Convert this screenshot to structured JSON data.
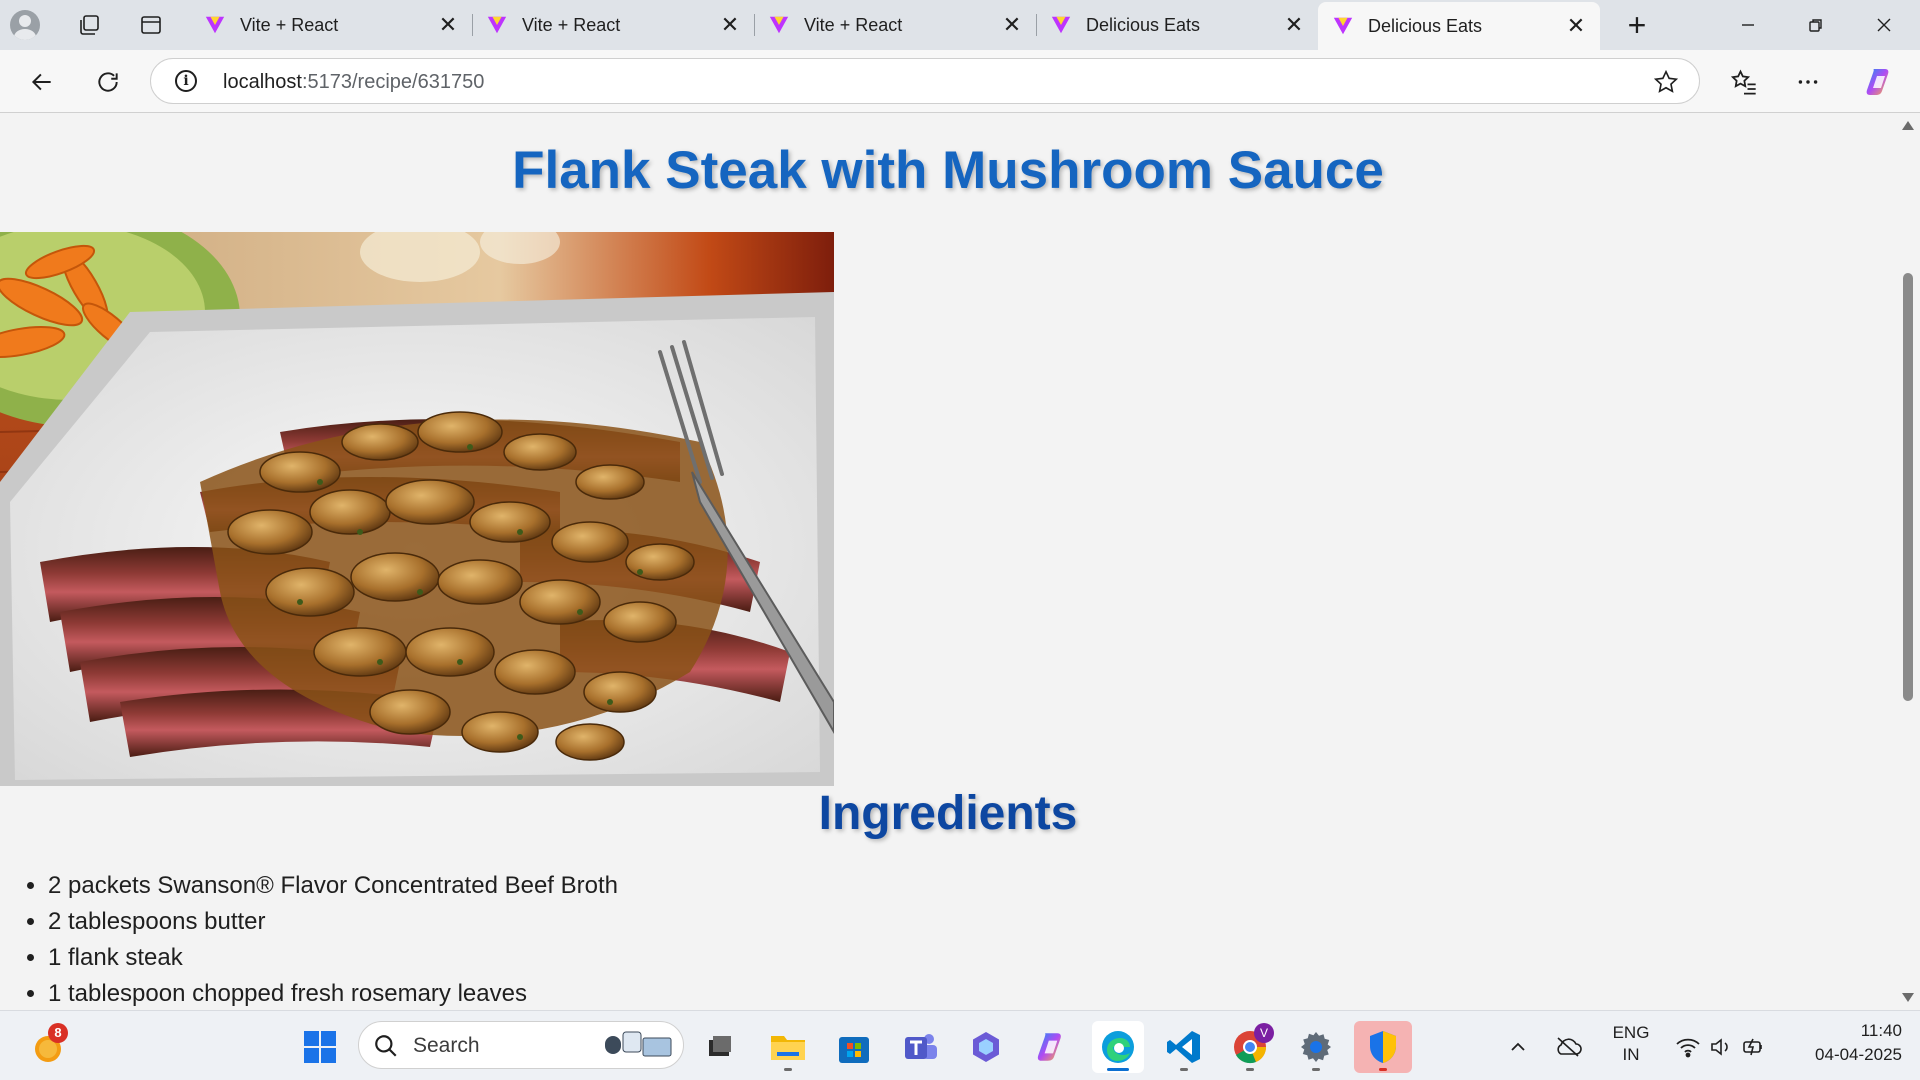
{
  "browser": {
    "tabs": [
      {
        "title": "Vite + React"
      },
      {
        "title": "Vite + React"
      },
      {
        "title": "Vite + React"
      },
      {
        "title": "Delicious Eats"
      },
      {
        "title": "Delicious Eats",
        "active": true
      }
    ],
    "url_host": "localhost",
    "url_path": ":5173/recipe/631750"
  },
  "page": {
    "title": "Flank Steak with Mushroom Sauce",
    "image_alt": "Flank Steak with Mushroom Sauce",
    "ingredients_heading": "Ingredients",
    "ingredients": [
      "2 packets Swanson® Flavor Concentrated Beef Broth",
      "2 tablespoons butter",
      "1 flank steak",
      "1 tablespoon chopped fresh rosemary leaves"
    ]
  },
  "taskbar": {
    "search_placeholder": "Search",
    "weather_badge": "8",
    "chrome_badge": "V",
    "language": "ENG",
    "region": "IN",
    "time": "11:40",
    "date": "04-04-2025"
  },
  "colors": {
    "title": "#1565c0",
    "heading": "#0d47a1",
    "page_bg": "#f3f3f3"
  }
}
